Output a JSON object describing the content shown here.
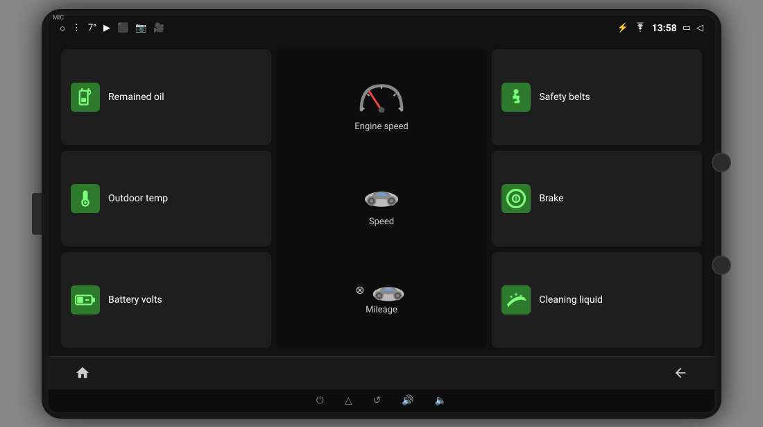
{
  "device": {
    "mic_label": "MIC"
  },
  "status_bar": {
    "temp": "7°",
    "time": "13:58",
    "icons": [
      "circle-icon",
      "menu-icon",
      "youtube-icon",
      "screen-icon",
      "camera-icon",
      "video-icon"
    ]
  },
  "tiles": [
    {
      "id": "remained-oil",
      "label": "Remained oil",
      "icon_name": "fuel-icon",
      "position": "top-left"
    },
    {
      "id": "safety-belts",
      "label": "Safety belts",
      "icon_name": "belt-icon",
      "position": "top-right"
    },
    {
      "id": "outdoor-temp",
      "label": "Outdoor temp",
      "icon_name": "temp-icon",
      "position": "mid-left"
    },
    {
      "id": "brake",
      "label": "Brake",
      "icon_name": "brake-icon",
      "position": "mid-right"
    },
    {
      "id": "battery-volts",
      "label": "Battery volts",
      "icon_name": "battery-icon",
      "position": "bot-left"
    },
    {
      "id": "cleaning-liquid",
      "label": "Cleaning liquid",
      "icon_name": "clean-icon",
      "position": "bot-right"
    }
  ],
  "center_tile": {
    "sections": [
      {
        "id": "engine-speed",
        "label": "Engine speed",
        "icon": "speedometer"
      },
      {
        "id": "speed",
        "label": "Speed",
        "icon": "car-front"
      },
      {
        "id": "mileage",
        "label": "Mileage",
        "icon": "car-warning"
      }
    ]
  },
  "nav_bar": {
    "home_label": "⌂",
    "back_label": "↩"
  },
  "system_bar": {
    "buttons": [
      "⏻",
      "△",
      "↺",
      "🔊",
      "🔈"
    ]
  }
}
